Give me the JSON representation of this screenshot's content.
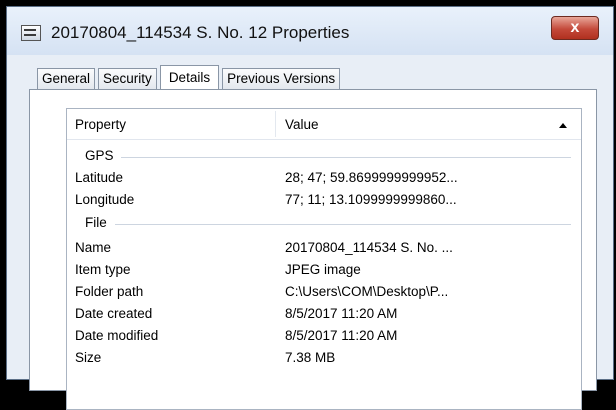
{
  "window": {
    "title": "20170804_114534 S. No. 12 Properties",
    "close_label": "x"
  },
  "tabs": [
    {
      "label": "General"
    },
    {
      "label": "Security"
    },
    {
      "label": "Details"
    },
    {
      "label": "Previous Versions"
    }
  ],
  "table": {
    "col_property": "Property",
    "col_value": "Value",
    "groups": {
      "gps": "GPS",
      "file": "File"
    },
    "gps_rows": [
      {
        "key": "Latitude",
        "value": "28; 47; 59.8699999999952..."
      },
      {
        "key": "Longitude",
        "value": "77; 11; 13.1099999999860..."
      }
    ],
    "file_rows": [
      {
        "key": "Name",
        "value": "20170804_114534 S. No. ..."
      },
      {
        "key": "Item type",
        "value": "JPEG image"
      },
      {
        "key": "Folder path",
        "value": "C:\\Users\\COM\\Desktop\\P..."
      },
      {
        "key": "Date created",
        "value": "8/5/2017 11:20 AM"
      },
      {
        "key": "Date modified",
        "value": "8/5/2017 11:20 AM"
      },
      {
        "key": "Size",
        "value": "7.38 MB"
      }
    ]
  }
}
